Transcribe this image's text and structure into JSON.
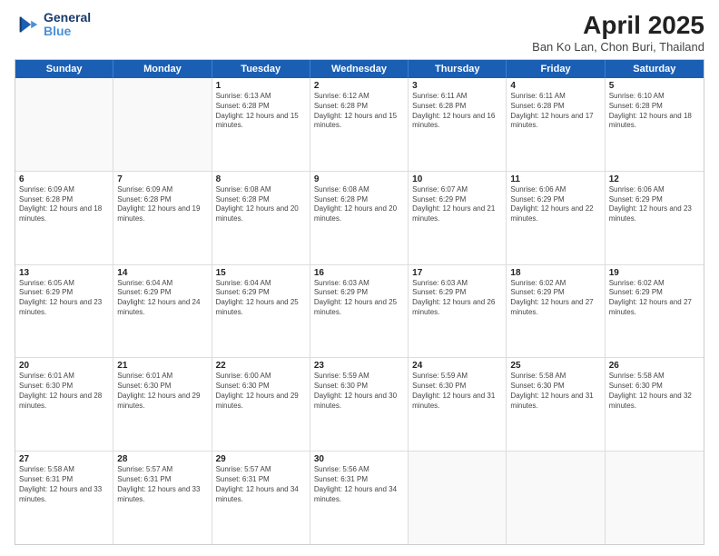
{
  "header": {
    "logo_line1": "General",
    "logo_line2": "Blue",
    "main_title": "April 2025",
    "subtitle": "Ban Ko Lan, Chon Buri, Thailand"
  },
  "days_of_week": [
    "Sunday",
    "Monday",
    "Tuesday",
    "Wednesday",
    "Thursday",
    "Friday",
    "Saturday"
  ],
  "weeks": [
    [
      {
        "day": "",
        "empty": true
      },
      {
        "day": "",
        "empty": true
      },
      {
        "day": "1",
        "sunrise": "Sunrise: 6:13 AM",
        "sunset": "Sunset: 6:28 PM",
        "daylight": "Daylight: 12 hours and 15 minutes."
      },
      {
        "day": "2",
        "sunrise": "Sunrise: 6:12 AM",
        "sunset": "Sunset: 6:28 PM",
        "daylight": "Daylight: 12 hours and 15 minutes."
      },
      {
        "day": "3",
        "sunrise": "Sunrise: 6:11 AM",
        "sunset": "Sunset: 6:28 PM",
        "daylight": "Daylight: 12 hours and 16 minutes."
      },
      {
        "day": "4",
        "sunrise": "Sunrise: 6:11 AM",
        "sunset": "Sunset: 6:28 PM",
        "daylight": "Daylight: 12 hours and 17 minutes."
      },
      {
        "day": "5",
        "sunrise": "Sunrise: 6:10 AM",
        "sunset": "Sunset: 6:28 PM",
        "daylight": "Daylight: 12 hours and 18 minutes."
      }
    ],
    [
      {
        "day": "6",
        "sunrise": "Sunrise: 6:09 AM",
        "sunset": "Sunset: 6:28 PM",
        "daylight": "Daylight: 12 hours and 18 minutes."
      },
      {
        "day": "7",
        "sunrise": "Sunrise: 6:09 AM",
        "sunset": "Sunset: 6:28 PM",
        "daylight": "Daylight: 12 hours and 19 minutes."
      },
      {
        "day": "8",
        "sunrise": "Sunrise: 6:08 AM",
        "sunset": "Sunset: 6:28 PM",
        "daylight": "Daylight: 12 hours and 20 minutes."
      },
      {
        "day": "9",
        "sunrise": "Sunrise: 6:08 AM",
        "sunset": "Sunset: 6:28 PM",
        "daylight": "Daylight: 12 hours and 20 minutes."
      },
      {
        "day": "10",
        "sunrise": "Sunrise: 6:07 AM",
        "sunset": "Sunset: 6:29 PM",
        "daylight": "Daylight: 12 hours and 21 minutes."
      },
      {
        "day": "11",
        "sunrise": "Sunrise: 6:06 AM",
        "sunset": "Sunset: 6:29 PM",
        "daylight": "Daylight: 12 hours and 22 minutes."
      },
      {
        "day": "12",
        "sunrise": "Sunrise: 6:06 AM",
        "sunset": "Sunset: 6:29 PM",
        "daylight": "Daylight: 12 hours and 23 minutes."
      }
    ],
    [
      {
        "day": "13",
        "sunrise": "Sunrise: 6:05 AM",
        "sunset": "Sunset: 6:29 PM",
        "daylight": "Daylight: 12 hours and 23 minutes."
      },
      {
        "day": "14",
        "sunrise": "Sunrise: 6:04 AM",
        "sunset": "Sunset: 6:29 PM",
        "daylight": "Daylight: 12 hours and 24 minutes."
      },
      {
        "day": "15",
        "sunrise": "Sunrise: 6:04 AM",
        "sunset": "Sunset: 6:29 PM",
        "daylight": "Daylight: 12 hours and 25 minutes."
      },
      {
        "day": "16",
        "sunrise": "Sunrise: 6:03 AM",
        "sunset": "Sunset: 6:29 PM",
        "daylight": "Daylight: 12 hours and 25 minutes."
      },
      {
        "day": "17",
        "sunrise": "Sunrise: 6:03 AM",
        "sunset": "Sunset: 6:29 PM",
        "daylight": "Daylight: 12 hours and 26 minutes."
      },
      {
        "day": "18",
        "sunrise": "Sunrise: 6:02 AM",
        "sunset": "Sunset: 6:29 PM",
        "daylight": "Daylight: 12 hours and 27 minutes."
      },
      {
        "day": "19",
        "sunrise": "Sunrise: 6:02 AM",
        "sunset": "Sunset: 6:29 PM",
        "daylight": "Daylight: 12 hours and 27 minutes."
      }
    ],
    [
      {
        "day": "20",
        "sunrise": "Sunrise: 6:01 AM",
        "sunset": "Sunset: 6:30 PM",
        "daylight": "Daylight: 12 hours and 28 minutes."
      },
      {
        "day": "21",
        "sunrise": "Sunrise: 6:01 AM",
        "sunset": "Sunset: 6:30 PM",
        "daylight": "Daylight: 12 hours and 29 minutes."
      },
      {
        "day": "22",
        "sunrise": "Sunrise: 6:00 AM",
        "sunset": "Sunset: 6:30 PM",
        "daylight": "Daylight: 12 hours and 29 minutes."
      },
      {
        "day": "23",
        "sunrise": "Sunrise: 5:59 AM",
        "sunset": "Sunset: 6:30 PM",
        "daylight": "Daylight: 12 hours and 30 minutes."
      },
      {
        "day": "24",
        "sunrise": "Sunrise: 5:59 AM",
        "sunset": "Sunset: 6:30 PM",
        "daylight": "Daylight: 12 hours and 31 minutes."
      },
      {
        "day": "25",
        "sunrise": "Sunrise: 5:58 AM",
        "sunset": "Sunset: 6:30 PM",
        "daylight": "Daylight: 12 hours and 31 minutes."
      },
      {
        "day": "26",
        "sunrise": "Sunrise: 5:58 AM",
        "sunset": "Sunset: 6:30 PM",
        "daylight": "Daylight: 12 hours and 32 minutes."
      }
    ],
    [
      {
        "day": "27",
        "sunrise": "Sunrise: 5:58 AM",
        "sunset": "Sunset: 6:31 PM",
        "daylight": "Daylight: 12 hours and 33 minutes."
      },
      {
        "day": "28",
        "sunrise": "Sunrise: 5:57 AM",
        "sunset": "Sunset: 6:31 PM",
        "daylight": "Daylight: 12 hours and 33 minutes."
      },
      {
        "day": "29",
        "sunrise": "Sunrise: 5:57 AM",
        "sunset": "Sunset: 6:31 PM",
        "daylight": "Daylight: 12 hours and 34 minutes."
      },
      {
        "day": "30",
        "sunrise": "Sunrise: 5:56 AM",
        "sunset": "Sunset: 6:31 PM",
        "daylight": "Daylight: 12 hours and 34 minutes."
      },
      {
        "day": "",
        "empty": true
      },
      {
        "day": "",
        "empty": true
      },
      {
        "day": "",
        "empty": true
      }
    ]
  ]
}
